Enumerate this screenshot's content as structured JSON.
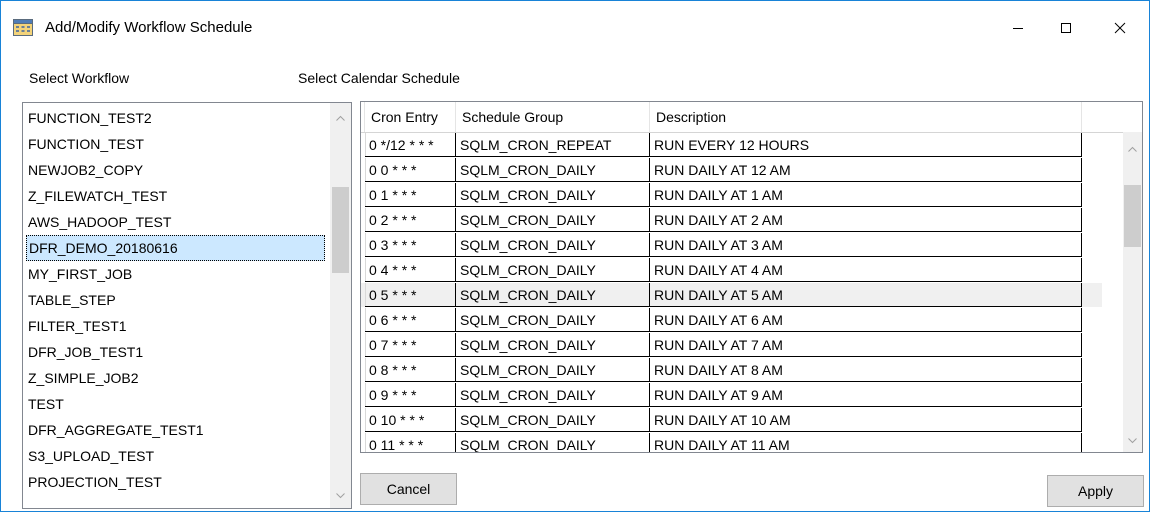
{
  "window": {
    "title": "Add/Modify Workflow Schedule"
  },
  "labels": {
    "select_workflow": "Select Workflow",
    "select_calendar": "Select Calendar Schedule"
  },
  "workflows": [
    "FUNCTION_TEST2",
    "FUNCTION_TEST",
    "NEWJOB2_COPY",
    "Z_FILEWATCH_TEST",
    "AWS_HADOOP_TEST",
    "DFR_DEMO_20180616",
    "MY_FIRST_JOB",
    "TABLE_STEP",
    "FILTER_TEST1",
    "DFR_JOB_TEST1",
    "Z_SIMPLE_JOB2",
    "TEST",
    "DFR_AGGREGATE_TEST1",
    "S3_UPLOAD_TEST",
    "PROJECTION_TEST"
  ],
  "selected_workflow": "DFR_DEMO_20180616",
  "grid": {
    "columns": [
      "Cron Entry",
      "Schedule Group",
      "Description"
    ],
    "rows": [
      [
        "0 */12 * * *",
        "SQLM_CRON_REPEAT",
        "RUN EVERY 12 HOURS"
      ],
      [
        "0 0 * * *",
        "SQLM_CRON_DAILY",
        "RUN DAILY AT 12 AM"
      ],
      [
        "0 1 * * *",
        "SQLM_CRON_DAILY",
        "RUN DAILY AT 1 AM"
      ],
      [
        "0 2 * * *",
        "SQLM_CRON_DAILY",
        "RUN DAILY AT 2 AM"
      ],
      [
        "0 3 * * *",
        "SQLM_CRON_DAILY",
        "RUN DAILY AT 3 AM"
      ],
      [
        "0 4 * * *",
        "SQLM_CRON_DAILY",
        "RUN DAILY AT 4 AM"
      ],
      [
        "0 5 * * *",
        "SQLM_CRON_DAILY",
        "RUN DAILY AT 5 AM"
      ],
      [
        "0 6 * * *",
        "SQLM_CRON_DAILY",
        "RUN DAILY AT 6 AM"
      ],
      [
        "0 7 * * *",
        "SQLM_CRON_DAILY",
        "RUN DAILY AT 7 AM"
      ],
      [
        "0 8 * * *",
        "SQLM_CRON_DAILY",
        "RUN DAILY AT 8 AM"
      ],
      [
        "0 9 * * *",
        "SQLM_CRON_DAILY",
        "RUN DAILY AT 9 AM"
      ],
      [
        "0 10 * * *",
        "SQLM_CRON_DAILY",
        "RUN DAILY AT 10 AM"
      ],
      [
        "0 11 * * *",
        "SQLM_CRON_DAILY",
        "RUN DAILY AT 11 AM"
      ]
    ],
    "hover_row_cron": "0 5 * * *"
  },
  "buttons": {
    "cancel": "Cancel",
    "apply": "Apply"
  },
  "icons": {
    "app": "calendar-icon",
    "minimize": "minimize-icon",
    "maximize": "maximize-icon",
    "close": "close-icon",
    "scroll_up": "chevron-up-icon",
    "scroll_down": "chevron-down-icon"
  },
  "colors": {
    "window_border": "#1883d7",
    "selection": "#cce8ff",
    "hover_row": "#f0f0f0",
    "button": "#e1e1e1"
  }
}
